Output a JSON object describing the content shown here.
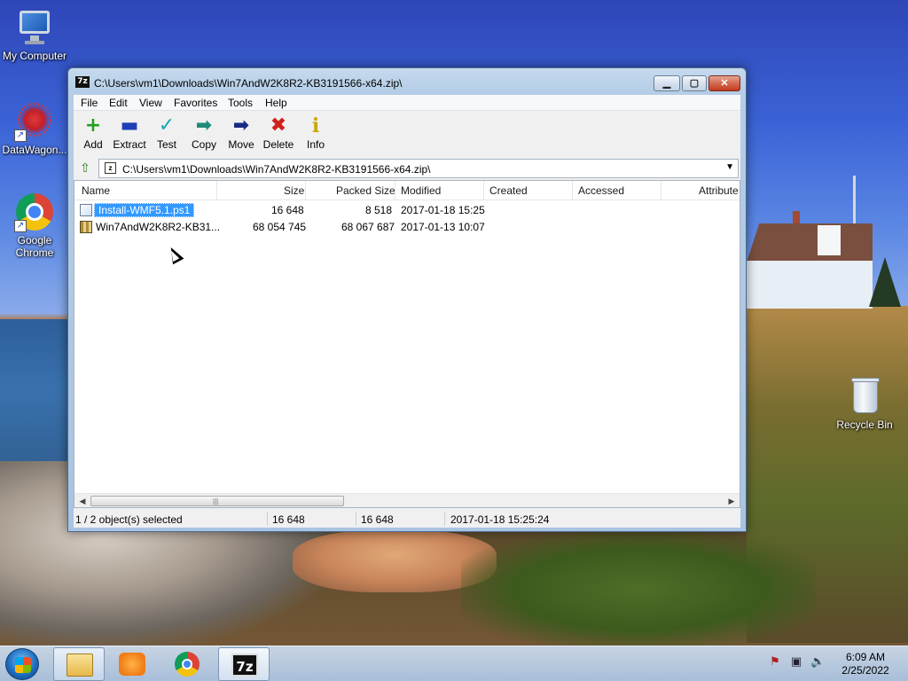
{
  "desktop": {
    "icons": [
      {
        "label": "My Computer"
      },
      {
        "label": "DataWagon..."
      },
      {
        "label": "Google Chrome"
      },
      {
        "label": "Recycle Bin"
      }
    ]
  },
  "window": {
    "app_badge": "7z",
    "title": "C:\\Users\\vm1\\Downloads\\Win7AndW2K8R2-KB3191566-x64.zip\\",
    "buttons": {
      "minimize": "▁",
      "maximize": "▢",
      "close": "✕"
    }
  },
  "menu": [
    "File",
    "Edit",
    "View",
    "Favorites",
    "Tools",
    "Help"
  ],
  "toolbar": [
    {
      "label": "Add",
      "icon": "plus-icon",
      "glyph": "+",
      "color": "#22a022"
    },
    {
      "label": "Extract",
      "icon": "minus-icon",
      "glyph": "▬",
      "color": "#1f3fb8"
    },
    {
      "label": "Test",
      "icon": "check-icon",
      "glyph": "✓",
      "color": "#17a6b5"
    },
    {
      "label": "Copy",
      "icon": "copy-arrow-icon",
      "glyph": "➡",
      "color": "#1f8a7a"
    },
    {
      "label": "Move",
      "icon": "move-arrow-icon",
      "glyph": "➡",
      "color": "#1a2a86"
    },
    {
      "label": "Delete",
      "icon": "delete-x-icon",
      "glyph": "✖",
      "color": "#d0201a"
    },
    {
      "label": "Info",
      "icon": "info-icon",
      "glyph": "i",
      "color": "#c9a800"
    }
  ],
  "address": {
    "path": "C:\\Users\\vm1\\Downloads\\Win7AndW2K8R2-KB3191566-x64.zip\\"
  },
  "columns": [
    "Name",
    "Size",
    "Packed Size",
    "Modified",
    "Created",
    "Accessed",
    "Attribute"
  ],
  "files": [
    {
      "name": "Install-WMF5.1.ps1",
      "size": "16 648",
      "packed": "8 518",
      "modified": "2017-01-18 15:25",
      "selected": true
    },
    {
      "name": "Win7AndW2K8R2-KB31...",
      "size": "68 054 745",
      "packed": "68 067 687",
      "modified": "2017-01-13 10:07",
      "selected": false
    }
  ],
  "status": {
    "selection": "1 / 2 object(s) selected",
    "size": "16 648",
    "packed": "16 648",
    "modified": "2017-01-18 15:25:24"
  },
  "taskbar": {
    "clock_time": "6:09 AM",
    "clock_date": "2/25/2022",
    "sevenzip_label": "7z"
  }
}
